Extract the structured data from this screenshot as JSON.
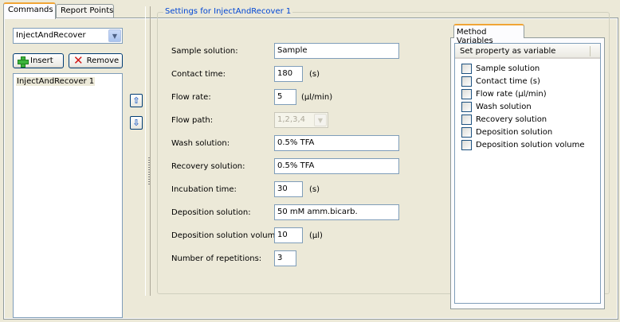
{
  "tabs": {
    "commands": "Commands",
    "report_points": "Report Points"
  },
  "command_select": {
    "value": "InjectAndRecover"
  },
  "buttons": {
    "insert": "Insert",
    "remove": "Remove"
  },
  "command_list": {
    "items": [
      "InjectAndRecover 1"
    ]
  },
  "settings": {
    "title": "Settings for InjectAndRecover 1",
    "sample_solution": {
      "label": "Sample solution:",
      "value": "Sample"
    },
    "contact_time": {
      "label": "Contact time:",
      "value": "180",
      "unit": "(s)"
    },
    "flow_rate": {
      "label": "Flow rate:",
      "value": "5",
      "unit": "(µl/min)"
    },
    "flow_path": {
      "label": "Flow path:",
      "value": "1,2,3,4"
    },
    "wash_solution": {
      "label": "Wash solution:",
      "value": "0.5% TFA"
    },
    "recovery_solution": {
      "label": "Recovery solution:",
      "value": "0.5% TFA"
    },
    "incubation_time": {
      "label": "Incubation time:",
      "value": "30",
      "unit": "(s)"
    },
    "deposition_solution": {
      "label": "Deposition solution:",
      "value": "50 mM amm.bicarb."
    },
    "deposition_volume": {
      "label": "Deposition solution volume:",
      "value": "10",
      "unit": "(µl)"
    },
    "repetitions": {
      "label": "Number of repetitions:",
      "value": "3"
    }
  },
  "method_variables": {
    "tab": "Method Variables",
    "header": "Set property as variable",
    "items": [
      "Sample solution",
      "Contact time (s)",
      "Flow rate (µl/min)",
      "Wash solution",
      "Recovery solution",
      "Deposition solution",
      "Deposition solution volume"
    ]
  }
}
